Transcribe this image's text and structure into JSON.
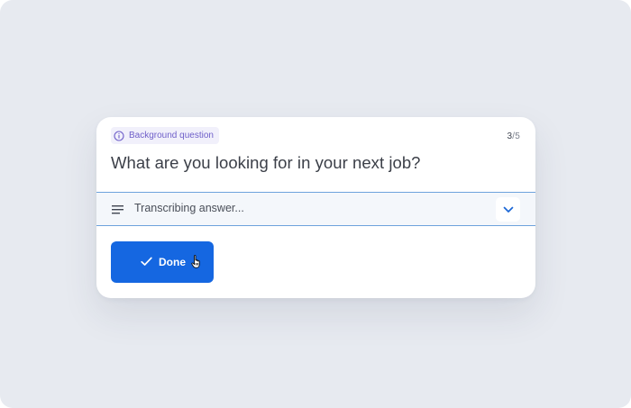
{
  "card": {
    "tag": {
      "label": "Background question",
      "icon": "info-icon",
      "color": "#6f5fc9"
    },
    "counter": {
      "current": "3",
      "total": "/5"
    },
    "question": "What are you looking for in your next job?",
    "transcription": {
      "icon": "lines-icon",
      "status": "Transcribing answer...",
      "expand_icon": "chevron-down-icon"
    },
    "done_button": {
      "label": "Done",
      "icon": "check-icon",
      "color": "#1567e1"
    }
  },
  "cursor": {
    "icon": "hand-pointer-icon"
  }
}
